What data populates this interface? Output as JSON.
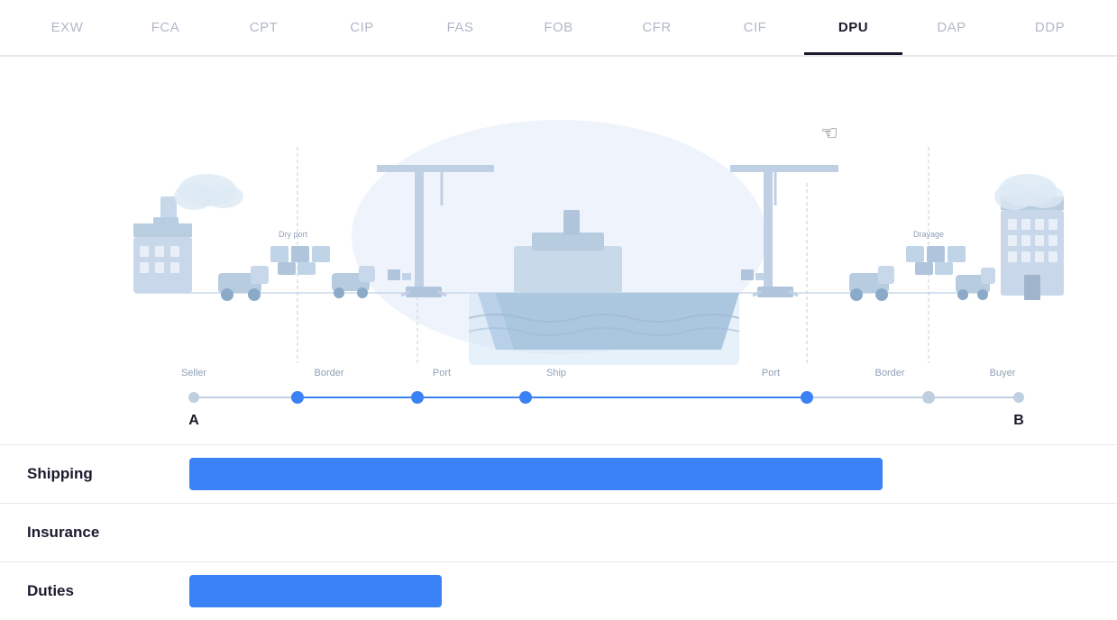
{
  "nav": {
    "tabs": [
      {
        "id": "exw",
        "label": "EXW",
        "active": false
      },
      {
        "id": "fca",
        "label": "FCA",
        "active": false
      },
      {
        "id": "cpt",
        "label": "CPT",
        "active": false
      },
      {
        "id": "cip",
        "label": "CIP",
        "active": false
      },
      {
        "id": "fas",
        "label": "FAS",
        "active": false
      },
      {
        "id": "fob",
        "label": "FOB",
        "active": false
      },
      {
        "id": "cfr",
        "label": "CFR",
        "active": false
      },
      {
        "id": "cif",
        "label": "CIF",
        "active": false
      },
      {
        "id": "dpu",
        "label": "DPU",
        "active": true
      },
      {
        "id": "dap",
        "label": "DAP",
        "active": false
      },
      {
        "id": "ddp",
        "label": "DDP",
        "active": false
      }
    ]
  },
  "diagram": {
    "locations": [
      {
        "id": "seller",
        "label": "Seller"
      },
      {
        "id": "border-left",
        "label": "Border"
      },
      {
        "id": "port-left",
        "label": "Port"
      },
      {
        "id": "ship",
        "label": "Ship"
      },
      {
        "id": "port-right",
        "label": "Port"
      },
      {
        "id": "border-right",
        "label": "Border"
      },
      {
        "id": "buyer",
        "label": "Buyer"
      }
    ],
    "point_a": "A",
    "point_b": "B",
    "label_dry_port": "Dry port",
    "label_drayage": "Drayage"
  },
  "legend": {
    "rows": [
      {
        "id": "shipping",
        "label": "Shipping",
        "bar_width_pct": 77,
        "has_bar": true
      },
      {
        "id": "insurance",
        "label": "Insurance",
        "bar_width_pct": 0,
        "has_bar": false
      },
      {
        "id": "duties",
        "label": "Duties",
        "bar_width_pct": 28,
        "has_bar": true
      }
    ]
  },
  "colors": {
    "accent_blue": "#3b82f6",
    "light_blue": "#a8c4e8",
    "pale_blue": "#dae8f8",
    "dark_navy": "#1a1a2e",
    "mid_gray": "#b0b8c8",
    "light_gray": "#e8e8e8"
  }
}
